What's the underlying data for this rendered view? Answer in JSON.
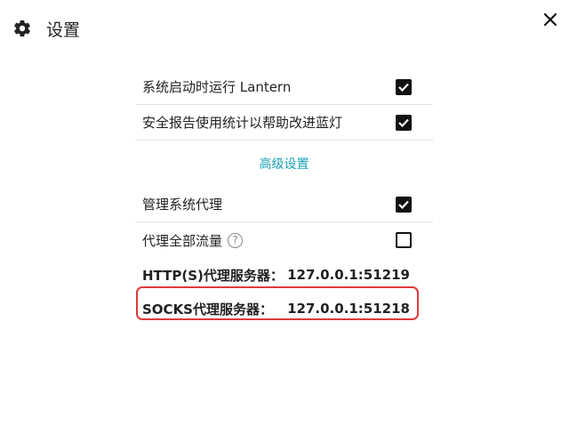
{
  "header": {
    "title": "设置",
    "icon": "gear-icon"
  },
  "settings": [
    {
      "label": "系统启动时运行 Lantern",
      "checked": true
    },
    {
      "label": "安全报告使用统计以帮助改进蓝灯",
      "checked": true
    }
  ],
  "advanced_label": "高级设置",
  "advanced_settings": [
    {
      "label": "管理系统代理",
      "checked": true
    },
    {
      "label": "代理全部流量",
      "checked": false,
      "help": "?"
    }
  ],
  "servers": [
    {
      "label": "HTTP(S)代理服务器：",
      "value": "127.0.0.1:51219"
    },
    {
      "label": "SOCKS代理服务器：",
      "value": "127.0.0.1:51218"
    }
  ],
  "colors": {
    "accent": "#1aa3b8",
    "highlight": "#e03a3a"
  }
}
